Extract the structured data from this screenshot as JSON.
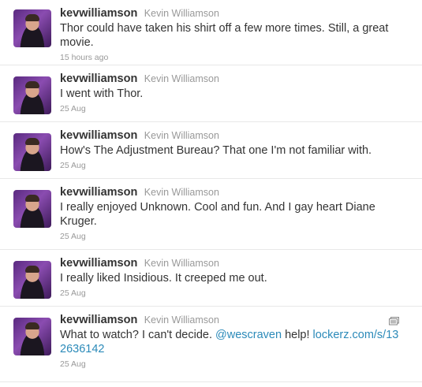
{
  "tweets": [
    {
      "screen_name": "kevwilliamson",
      "full_name": "Kevin Williamson",
      "text": "Thor could have taken his shirt off a few more times. Still, a great movie.",
      "time": "15 hours ago"
    },
    {
      "screen_name": "kevwilliamson",
      "full_name": "Kevin Williamson",
      "text": "I went with Thor.",
      "time": "25 Aug"
    },
    {
      "screen_name": "kevwilliamson",
      "full_name": "Kevin Williamson",
      "text": "How's The Adjustment Bureau? That one I'm not familiar with.",
      "time": "25 Aug"
    },
    {
      "screen_name": "kevwilliamson",
      "full_name": "Kevin Williamson",
      "text": "I really enjoyed Unknown. Cool and fun. And I gay heart Diane Kruger.",
      "time": "25 Aug"
    },
    {
      "screen_name": "kevwilliamson",
      "full_name": "Kevin Williamson",
      "text": "I really liked Insidious. It creeped me out.",
      "time": "25 Aug"
    },
    {
      "screen_name": "kevwilliamson",
      "full_name": "Kevin Williamson",
      "text_part1": "What to watch? I can't decide. ",
      "mention": "@wescraven",
      "text_part2": " help! ",
      "url": "lockerz.com/s/132636142",
      "time": "25 Aug",
      "media_icon": "photo-icon"
    }
  ],
  "colors": {
    "link": "#2b8ab9",
    "screen_name": "#333333",
    "muted": "#999999",
    "divider": "#e8e8e8"
  }
}
